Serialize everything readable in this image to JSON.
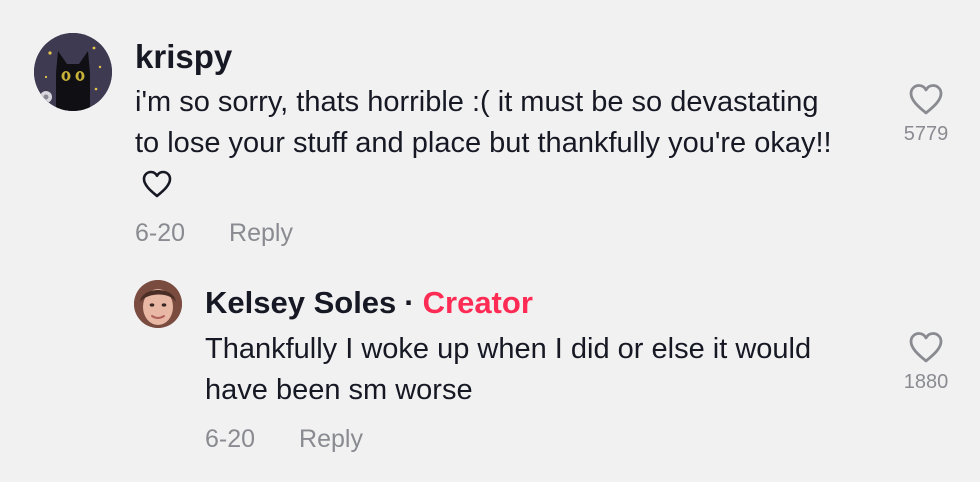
{
  "comment": {
    "username": "krispy",
    "text": "i'm so sorry, thats horrible :( it must be so devastating to lose your stuff and place but thankfully you're okay!!",
    "date": "6-20",
    "reply_label": "Reply",
    "like_count": "5779",
    "inline_icon": "heart-outline-icon"
  },
  "reply": {
    "username": "Kelsey Soles",
    "separator": "·",
    "badge": "Creator",
    "text": "Thankfully I woke up when I did or else it would have been sm worse",
    "date": "6-20",
    "reply_label": "Reply",
    "like_count": "1880"
  },
  "colors": {
    "background": "#f1f1f2",
    "text": "#161823",
    "muted": "#8a8b91",
    "creator_badge": "#fe2c55"
  }
}
